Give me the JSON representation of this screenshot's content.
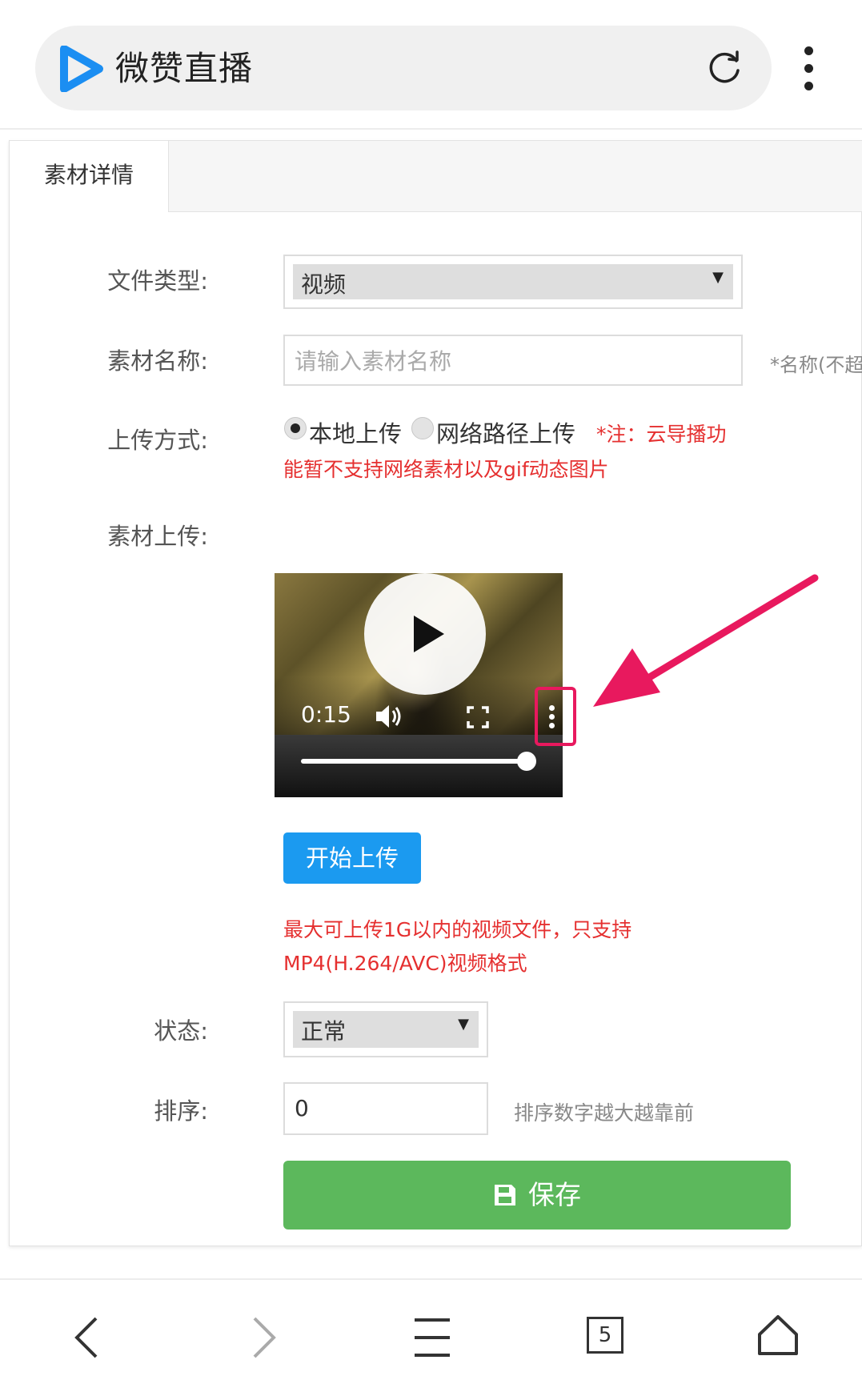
{
  "browser": {
    "site_title": "微赞直播",
    "tab_count": "5"
  },
  "tab": {
    "label": "素材详情"
  },
  "form": {
    "file_type": {
      "label": "文件类型:",
      "value": "视频"
    },
    "name": {
      "label": "素材名称:",
      "placeholder": "请输入素材名称",
      "hint": "*名称(不超"
    },
    "upload_method": {
      "label": "上传方式:",
      "option_local": "本地上传",
      "option_network": "网络路径上传",
      "note_line1": "*注：云导播功",
      "note_line2": "能暂不支持网络素材以及gif动态图片",
      "selected": "本地上传"
    },
    "material_upload": {
      "label": "素材上传:"
    },
    "video": {
      "time": "0:15",
      "progress": 0.92
    },
    "start_upload_label": "开始上传",
    "upload_note_line1": "最大可上传1G以内的视频文件，只支持",
    "upload_note_line2": "MP4(H.264/AVC)视频格式",
    "status": {
      "label": "状态:",
      "value": "正常"
    },
    "sort": {
      "label": "排序:",
      "value": "0",
      "hint": "排序数字越大越靠前"
    },
    "save_label": "保存"
  },
  "colors": {
    "brand_blue": "#1b9af0",
    "save_green": "#5cb85c",
    "note_red": "#e53030",
    "annotation_pink": "#e8195e"
  },
  "icons": [
    "logo-play-icon",
    "reload-icon",
    "more-vert-icon",
    "volume-icon",
    "fullscreen-icon",
    "video-more-icon",
    "save-icon",
    "back-icon",
    "forward-icon",
    "menu-icon",
    "tabs-icon",
    "home-icon"
  ]
}
